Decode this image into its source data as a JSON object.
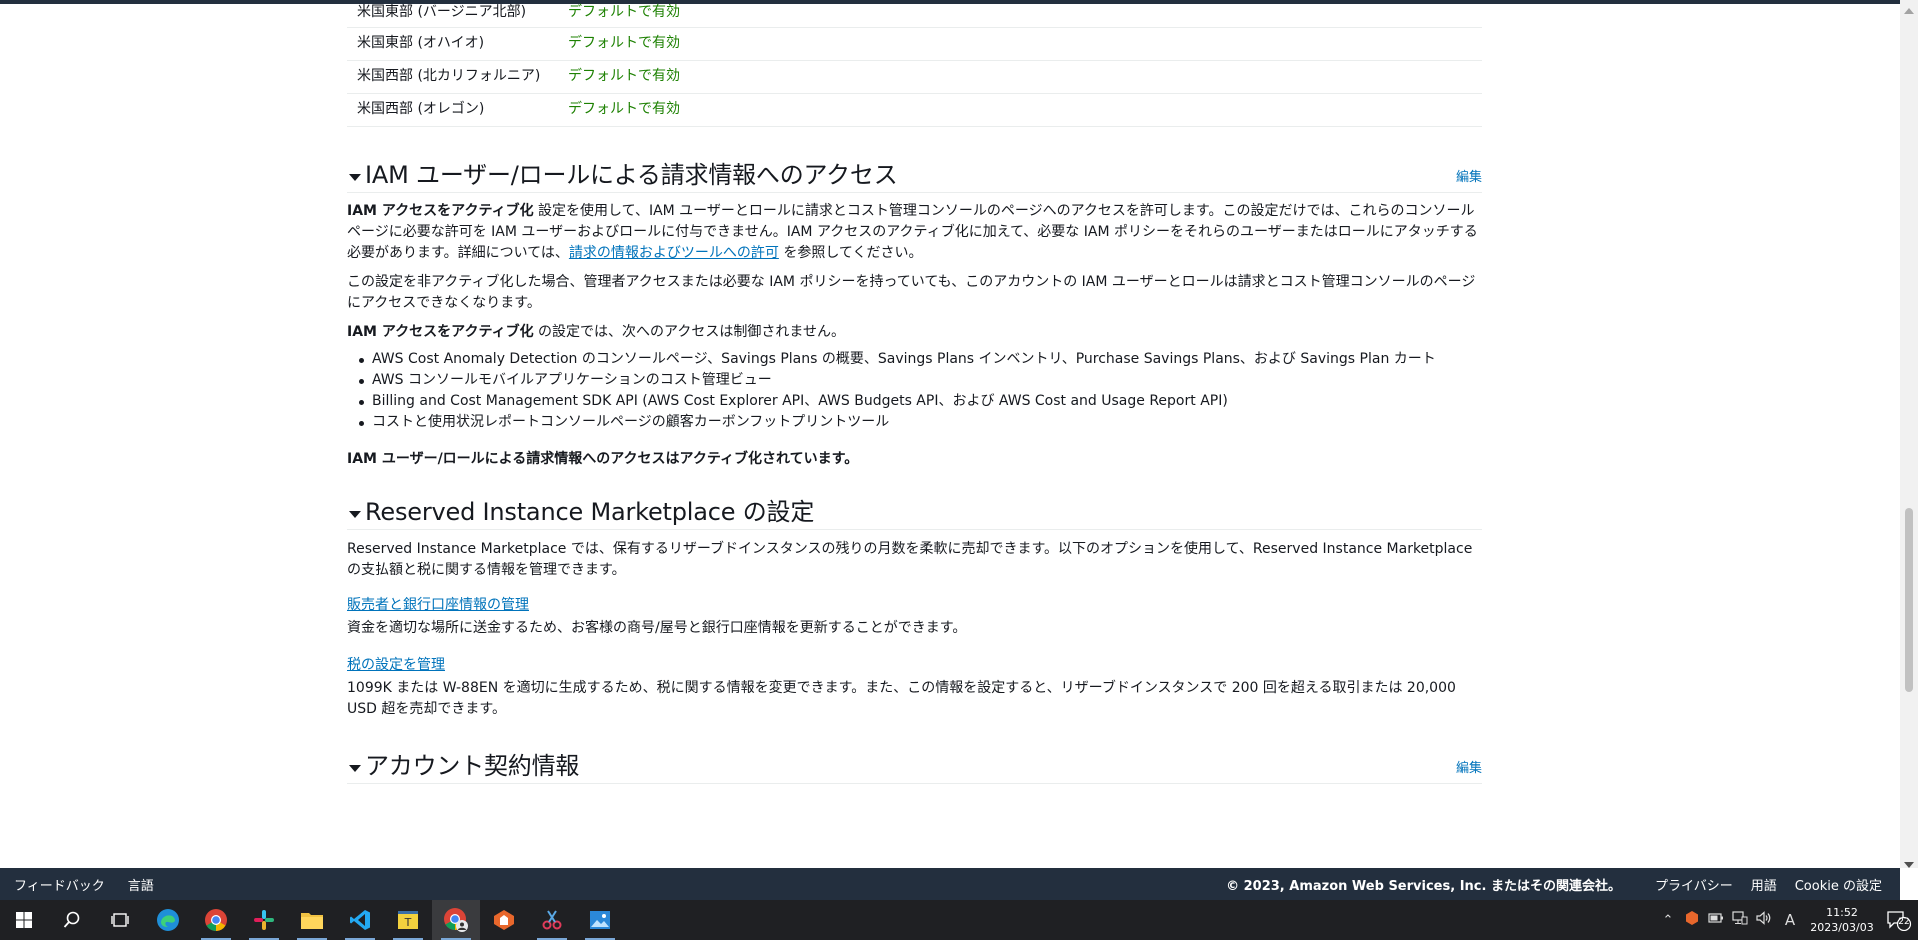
{
  "regions": [
    {
      "name": "米国東部 (バージニア北部)",
      "status": "デフォルトで有効"
    },
    {
      "name": "米国東部 (オハイオ)",
      "status": "デフォルトで有効"
    },
    {
      "name": "米国西部 (北カリフォルニア)",
      "status": "デフォルトで有効"
    },
    {
      "name": "米国西部 (オレゴン)",
      "status": "デフォルトで有効"
    }
  ],
  "iam": {
    "title": "IAM ユーザー/ロールによる請求情報へのアクセス",
    "edit": "編集",
    "p1_bold": "IAM アクセスをアクティブ化",
    "p1_text": " 設定を使用して、IAM ユーザーとロールに請求とコスト管理コンソールのページへのアクセスを許可します。この設定だけでは、これらのコンソールページに必要な許可を IAM ユーザーおよびロールに付与できません。IAM アクセスのアクティブ化に加えて、必要な IAM ポリシーをそれらのユーザーまたはロールにアタッチする必要があります。詳細については、",
    "p1_link": "請求の情報およびツールへの許可",
    "p1_end": " を参照してください。",
    "p2": "この設定を非アクティブ化した場合、管理者アクセスまたは必要な IAM ポリシーを持っていても、このアカウントの IAM ユーザーとロールは請求とコスト管理コンソールのページにアクセスできなくなります。",
    "p3_bold": "IAM アクセスをアクティブ化",
    "p3_text": " の設定では、次へのアクセスは制御されません。",
    "list": [
      "AWS Cost Anomaly Detection のコンソールページ、Savings Plans の概要、Savings Plans インベントリ、Purchase Savings Plans、および Savings Plan カート",
      "AWS コンソールモバイルアプリケーションのコスト管理ビュー",
      "Billing and Cost Management SDK API (AWS Cost Explorer API、AWS Budgets API、および AWS Cost and Usage Report API)",
      "コストと使用状況レポートコンソールページの顧客カーボンフットプリントツール"
    ],
    "status": "IAM ユーザー/ロールによる請求情報へのアクセスはアクティブ化されています。"
  },
  "ri": {
    "title": "Reserved Instance Marketplace の設定",
    "desc": "Reserved Instance Marketplace では、保有するリザーブドインスタンスの残りの月数を柔軟に売却できます。以下のオプションを使用して、Reserved Instance Marketplace の支払額と税に関する情報を管理できます。",
    "seller_link": "販売者と銀行口座情報の管理",
    "seller_desc": "資金を適切な場所に送金するため、お客様の商号/屋号と銀行口座情報を更新することができます。",
    "tax_link": "税の設定を管理",
    "tax_desc": "1099K または W-88EN を適切に生成するため、税に関する情報を変更できます。また、この情報を設定すると、リザーブドインスタンスで 200 回を超える取引または 20,000 USD 超を売却できます。"
  },
  "contract": {
    "title": "アカウント契約情報",
    "edit": "編集"
  },
  "footer": {
    "feedback": "フィードバック",
    "language": "言語",
    "copyright": "© 2023, Amazon Web Services, Inc. またはその関連会社。",
    "privacy": "プライバシー",
    "terms": "用語",
    "cookie": "Cookie の設定"
  },
  "taskbar": {
    "apps": [
      "windows-start-icon",
      "search-icon",
      "task-view-icon",
      "edge-icon",
      "chrome-icon",
      "slack-icon",
      "file-explorer-icon",
      "vscode-icon",
      "text-editor-icon",
      "chrome-profile-icon",
      "app-icon",
      "snipping-tool-icon",
      "photos-icon"
    ],
    "time": "11:52",
    "date": "2023/03/03",
    "ime": "A",
    "notifications": "22"
  },
  "colors": {
    "link": "#0073bb",
    "enabled": "#1d8102",
    "footer_bg": "#232f3e",
    "taskbar_bg": "#1f2023"
  }
}
